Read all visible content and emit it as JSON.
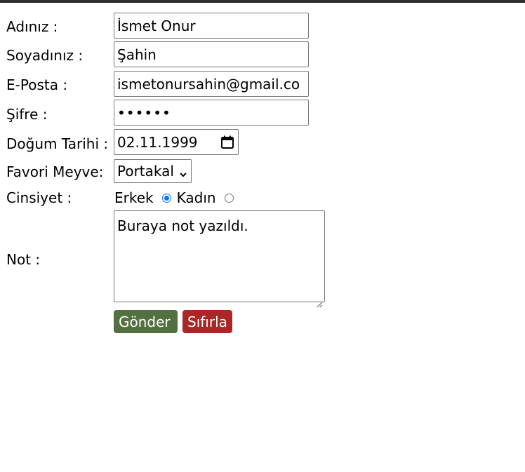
{
  "form": {
    "name_label": "Adınız :",
    "name_value": "İsmet Onur",
    "surname_label": "Soyadınız :",
    "surname_value": "Şahin",
    "email_label": "E-Posta :",
    "email_value": "ismetonursahin@gmail.co",
    "password_label": "Şifre :",
    "password_value": "••••••",
    "birthdate_label": "Doğum Tarihi :",
    "birthdate_value": "02.11.1999",
    "fruit_label": "Favori Meyve:",
    "fruit_value": "Portakal",
    "gender_label": "Cinsiyet :",
    "gender_options": [
      {
        "label": "Erkek",
        "checked": true
      },
      {
        "label": "Kadın",
        "checked": false
      }
    ],
    "note_label": "Not :",
    "note_value": "Buraya not yazıldı.",
    "submit_label": "Gönder",
    "reset_label": "Sıfırla"
  },
  "colors": {
    "topbar": "#2f2f2f",
    "submit_button": "#557040",
    "reset_button": "#ab2626",
    "radio_accent": "#0075ff"
  },
  "icons": {
    "date_picker": "calendar-icon",
    "select_arrow": "chevron-down-icon",
    "textarea_resize": "resize-grip-icon"
  }
}
